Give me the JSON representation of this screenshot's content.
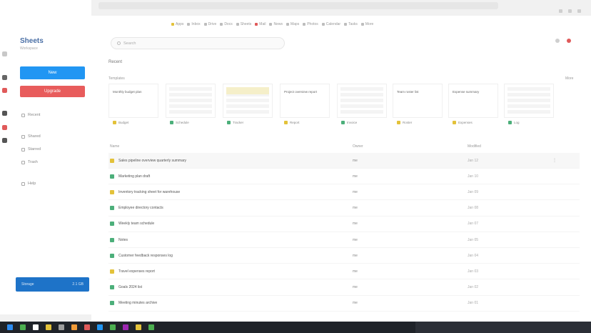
{
  "browser": {
    "bookmarks": [
      {
        "label": "Apps",
        "color": "yellow"
      },
      {
        "label": "Inbox",
        "color": "gray"
      },
      {
        "label": "Drive",
        "color": "gray"
      },
      {
        "label": "Docs",
        "color": "gray"
      },
      {
        "label": "Sheets",
        "color": "gray"
      },
      {
        "label": "Mail",
        "color": "red"
      },
      {
        "label": "News",
        "color": "gray"
      },
      {
        "label": "Maps",
        "color": "gray"
      },
      {
        "label": "Photos",
        "color": "gray"
      },
      {
        "label": "Calendar",
        "color": "gray"
      },
      {
        "label": "Tasks",
        "color": "gray"
      },
      {
        "label": "More",
        "color": "gray"
      }
    ]
  },
  "sidebar": {
    "logo": "Sheets",
    "logo_sub": "Workspace",
    "new_button": "New",
    "upgrade_button": "Upgrade",
    "nav": [
      "Recent",
      "Shared",
      "Starred",
      "Trash",
      "Help"
    ],
    "bottom_panel": {
      "label": "Storage",
      "value": "2.1 GB"
    }
  },
  "main": {
    "search_placeholder": "Search",
    "section_title": "Recent",
    "section_sub": "Templates",
    "more_link": "More",
    "thumbnails": [
      {
        "title": "Monthly budget plan",
        "label": "Budget",
        "kind": "text",
        "color": "#e3c23a"
      },
      {
        "title": "",
        "label": "Schedule",
        "kind": "list",
        "color": "#4caf7a"
      },
      {
        "title": "",
        "label": "Tracker",
        "kind": "yellow",
        "color": "#4caf7a"
      },
      {
        "title": "Project overview report",
        "label": "Report",
        "kind": "text",
        "color": "#e3c23a"
      },
      {
        "title": "",
        "label": "Invoice",
        "kind": "grid",
        "color": "#4caf7a"
      },
      {
        "title": "Team roster list",
        "label": "Roster",
        "kind": "text",
        "color": "#e3c23a"
      },
      {
        "title": "Expense summary",
        "label": "Expenses",
        "kind": "text",
        "color": "#e3c23a"
      },
      {
        "title": "",
        "label": "Log",
        "kind": "grid",
        "color": "#4caf7a"
      }
    ],
    "columns": {
      "name": "Name",
      "owner": "Owner",
      "modified": "Modified"
    },
    "rows": [
      {
        "name": "Sales pipeline overview quarterly summary",
        "owner": "me",
        "date": "Jan 12",
        "color": "#e3c23a",
        "hover": true
      },
      {
        "name": "Marketing plan draft",
        "owner": "me",
        "date": "Jan 10",
        "color": "#4caf7a",
        "hover": false
      },
      {
        "name": "Inventory tracking sheet for warehouse",
        "owner": "me",
        "date": "Jan 09",
        "color": "#e3c23a",
        "hover": false
      },
      {
        "name": "Employee directory contacts",
        "owner": "me",
        "date": "Jan 08",
        "color": "#4caf7a",
        "hover": false
      },
      {
        "name": "Weekly team schedule",
        "owner": "me",
        "date": "Jan 07",
        "color": "#4caf7a",
        "hover": false
      },
      {
        "name": "Notes",
        "owner": "me",
        "date": "Jan 05",
        "color": "#4caf7a",
        "hover": false
      },
      {
        "name": "Customer feedback responses log",
        "owner": "me",
        "date": "Jan 04",
        "color": "#4caf7a",
        "hover": false
      },
      {
        "name": "Travel expenses report",
        "owner": "me",
        "date": "Jan 03",
        "color": "#e3c23a",
        "hover": false
      },
      {
        "name": "Goals 2024 list",
        "owner": "me",
        "date": "Jan 02",
        "color": "#4caf7a",
        "hover": false
      },
      {
        "name": "Meeting minutes archive",
        "owner": "me",
        "date": "Jan 01",
        "color": "#4caf7a",
        "hover": false
      }
    ],
    "row_menu": "⋮"
  },
  "taskbar": {
    "icons": [
      "#2d8cf0",
      "#4caf50",
      "#fff",
      "#e3c23a",
      "#9e9e9e",
      "#f29b38",
      "#e05a5a",
      "#2196f3",
      "#4caf50",
      "#9c27b0",
      "#e3c23a",
      "#4caf50"
    ]
  }
}
